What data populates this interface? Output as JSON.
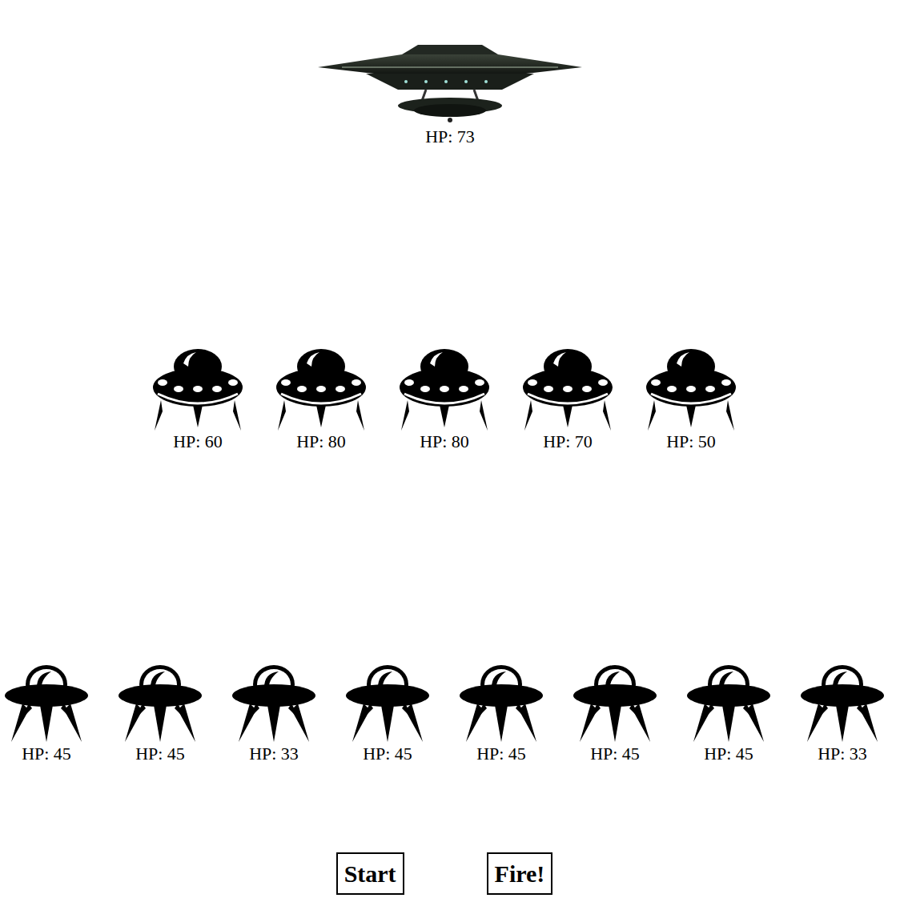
{
  "mothership": {
    "hp": "HP: 73"
  },
  "middle_row": [
    {
      "hp": "HP: 60"
    },
    {
      "hp": "HP: 80"
    },
    {
      "hp": "HP: 80"
    },
    {
      "hp": "HP: 70"
    },
    {
      "hp": "HP: 50"
    }
  ],
  "bottom_row": [
    {
      "hp": "HP: 45"
    },
    {
      "hp": "HP: 45"
    },
    {
      "hp": "HP: 33"
    },
    {
      "hp": "HP: 45"
    },
    {
      "hp": "HP: 45"
    },
    {
      "hp": "HP: 45"
    },
    {
      "hp": "HP: 45"
    },
    {
      "hp": "HP: 33"
    }
  ],
  "buttons": [
    "Start",
    "Fire!"
  ]
}
